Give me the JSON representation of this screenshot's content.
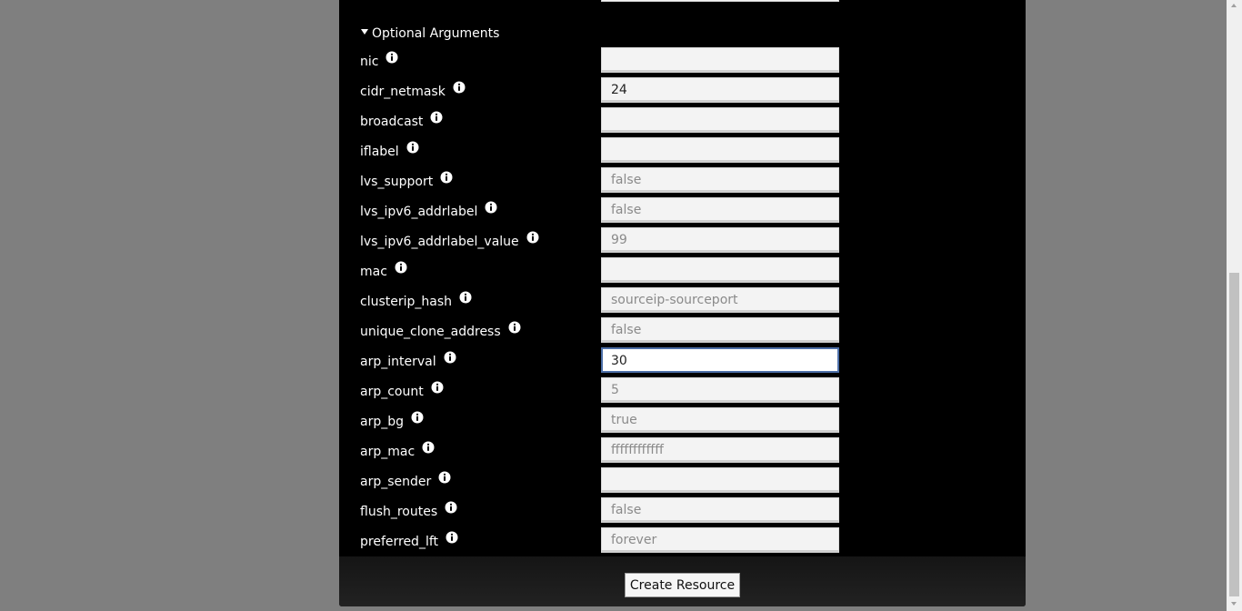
{
  "section": {
    "title": "Optional Arguments"
  },
  "fields": [
    {
      "label": "nic",
      "value": "",
      "placeholder": ""
    },
    {
      "label": "cidr_netmask",
      "value": "24",
      "placeholder": ""
    },
    {
      "label": "broadcast",
      "value": "",
      "placeholder": ""
    },
    {
      "label": "iflabel",
      "value": "",
      "placeholder": ""
    },
    {
      "label": "lvs_support",
      "value": "",
      "placeholder": "false"
    },
    {
      "label": "lvs_ipv6_addrlabel",
      "value": "",
      "placeholder": "false"
    },
    {
      "label": "lvs_ipv6_addrlabel_value",
      "value": "",
      "placeholder": "99"
    },
    {
      "label": "mac",
      "value": "",
      "placeholder": ""
    },
    {
      "label": "clusterip_hash",
      "value": "",
      "placeholder": "sourceip-sourceport"
    },
    {
      "label": "unique_clone_address",
      "value": "",
      "placeholder": "false"
    },
    {
      "label": "arp_interval",
      "value": "30",
      "placeholder": "",
      "focused": true
    },
    {
      "label": "arp_count",
      "value": "",
      "placeholder": "5"
    },
    {
      "label": "arp_bg",
      "value": "",
      "placeholder": "true"
    },
    {
      "label": "arp_mac",
      "value": "",
      "placeholder": "ffffffffffff"
    },
    {
      "label": "arp_sender",
      "value": "",
      "placeholder": ""
    },
    {
      "label": "flush_routes",
      "value": "",
      "placeholder": "false"
    },
    {
      "label": "preferred_lft",
      "value": "",
      "placeholder": "forever"
    }
  ],
  "footer": {
    "create_label": "Create Resource"
  },
  "icons": {
    "info": "info-icon",
    "toggle": "triangle-down-icon"
  },
  "colors": {
    "dialog_background": "#000000",
    "page_background": "#7f7f7f",
    "focus_border": "#4d6fa8"
  }
}
